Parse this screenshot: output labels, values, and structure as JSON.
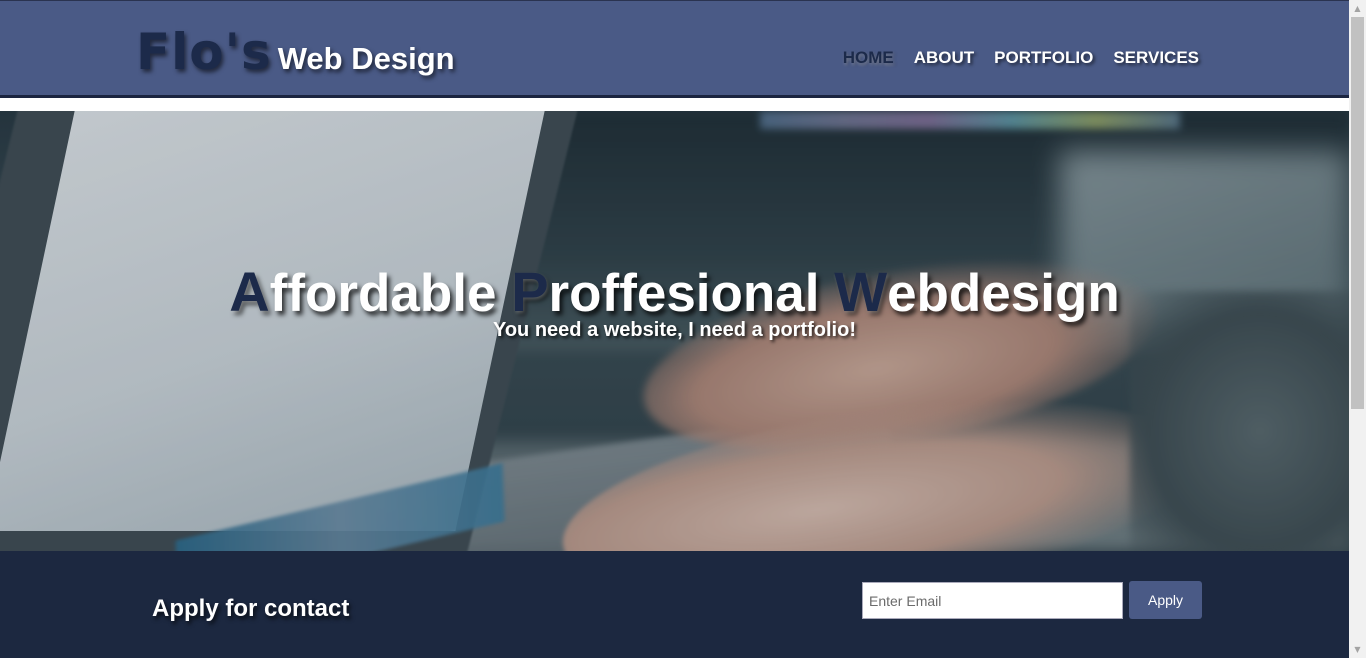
{
  "header": {
    "logo_name": "Flo's",
    "logo_sub": "Web Design",
    "nav": [
      {
        "label": "HOME",
        "active": true
      },
      {
        "label": "ABOUT",
        "active": false
      },
      {
        "label": "PORTFOLIO",
        "active": false
      },
      {
        "label": "SERVICES",
        "active": false
      }
    ]
  },
  "hero": {
    "title_words": [
      {
        "cap": "A",
        "rest": "ffordable"
      },
      {
        "cap": "P",
        "rest": "roffesional"
      },
      {
        "cap": "W",
        "rest": "ebdesign"
      }
    ],
    "subtitle": "You need a website, I need a portfolio!"
  },
  "contact": {
    "title": "Apply for contact",
    "email_placeholder": "Enter Email",
    "email_value": "",
    "apply_label": "Apply"
  },
  "colors": {
    "header_bg": "#4a5a86",
    "brand_dark": "#1c2a4a",
    "contact_bg": "#1c2840",
    "button_bg": "#4a5a86"
  },
  "icons": {
    "scroll_up": "scroll-up-arrow-icon",
    "scroll_down": "scroll-down-arrow-icon"
  }
}
